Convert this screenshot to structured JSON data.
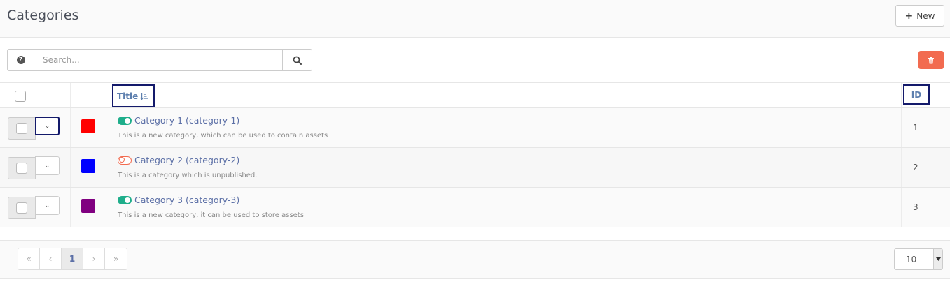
{
  "header": {
    "title": "Categories",
    "new_button_label": "New"
  },
  "toolbar": {
    "search_placeholder": "Search...",
    "delete_color": "#f26b50"
  },
  "table": {
    "columns": {
      "title": "Title",
      "id": "ID"
    },
    "rows": [
      {
        "title": "Category 1 (category-1)",
        "description": "This is a new category, which can be used to contain assets",
        "id": "1",
        "color": "#ff0000",
        "published": true
      },
      {
        "title": "Category 2 (category-2)",
        "description": "This is a category which is unpublished.",
        "id": "2",
        "color": "#0000ff",
        "published": false
      },
      {
        "title": "Category 3 (category-3)",
        "description": "This is a new category, it can be used to store assets",
        "id": "3",
        "color": "#800080",
        "published": true
      }
    ]
  },
  "pagination": {
    "first": "«",
    "prev": "‹",
    "current": "1",
    "next": "›",
    "last": "»"
  },
  "page_size": {
    "value": "10"
  },
  "colors": {
    "published_toggle": "#1fae8b",
    "unpublished_toggle": "#f26b50",
    "link": "#5b6fa6"
  }
}
